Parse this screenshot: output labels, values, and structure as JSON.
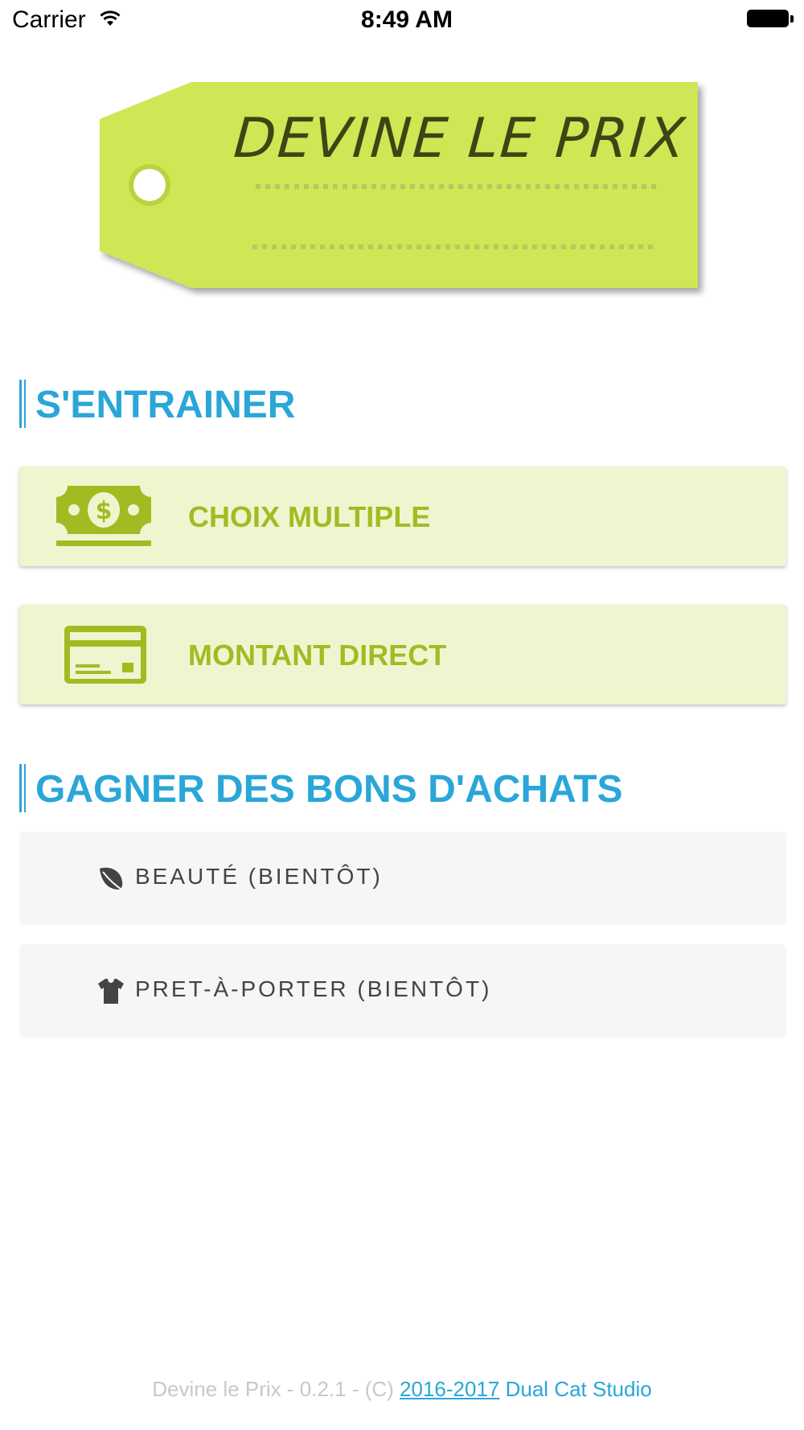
{
  "status_bar": {
    "carrier": "Carrier",
    "time": "8:49 AM"
  },
  "logo": {
    "title": "DEVINE LE PRIX",
    "tag_color": "#d0e655",
    "text_color": "#3e4514"
  },
  "sections": {
    "practice": {
      "heading": "S'ENTRAINER",
      "modes": [
        {
          "label": "CHOIX MULTIPLE",
          "icon": "money-bill-icon"
        },
        {
          "label": "MONTANT DIRECT",
          "icon": "credit-card-icon"
        }
      ]
    },
    "vouchers": {
      "heading": "GAGNER DES BONS D'ACHATS",
      "items": [
        {
          "label": "BEAUTÉ (BIENTÔT)",
          "icon": "leaf-icon"
        },
        {
          "label": "PRET-À-PORTER (BIENTÔT)",
          "icon": "tshirt-icon"
        }
      ]
    }
  },
  "footer": {
    "prefix": "Devine le Prix - 0.2.1 - (C) ",
    "years": "2016-2017",
    "studio": " Dual Cat Studio"
  },
  "colors": {
    "accent_blue": "#2aa6d8",
    "accent_green": "#a3bb23",
    "button_bg": "#eef6d0"
  }
}
